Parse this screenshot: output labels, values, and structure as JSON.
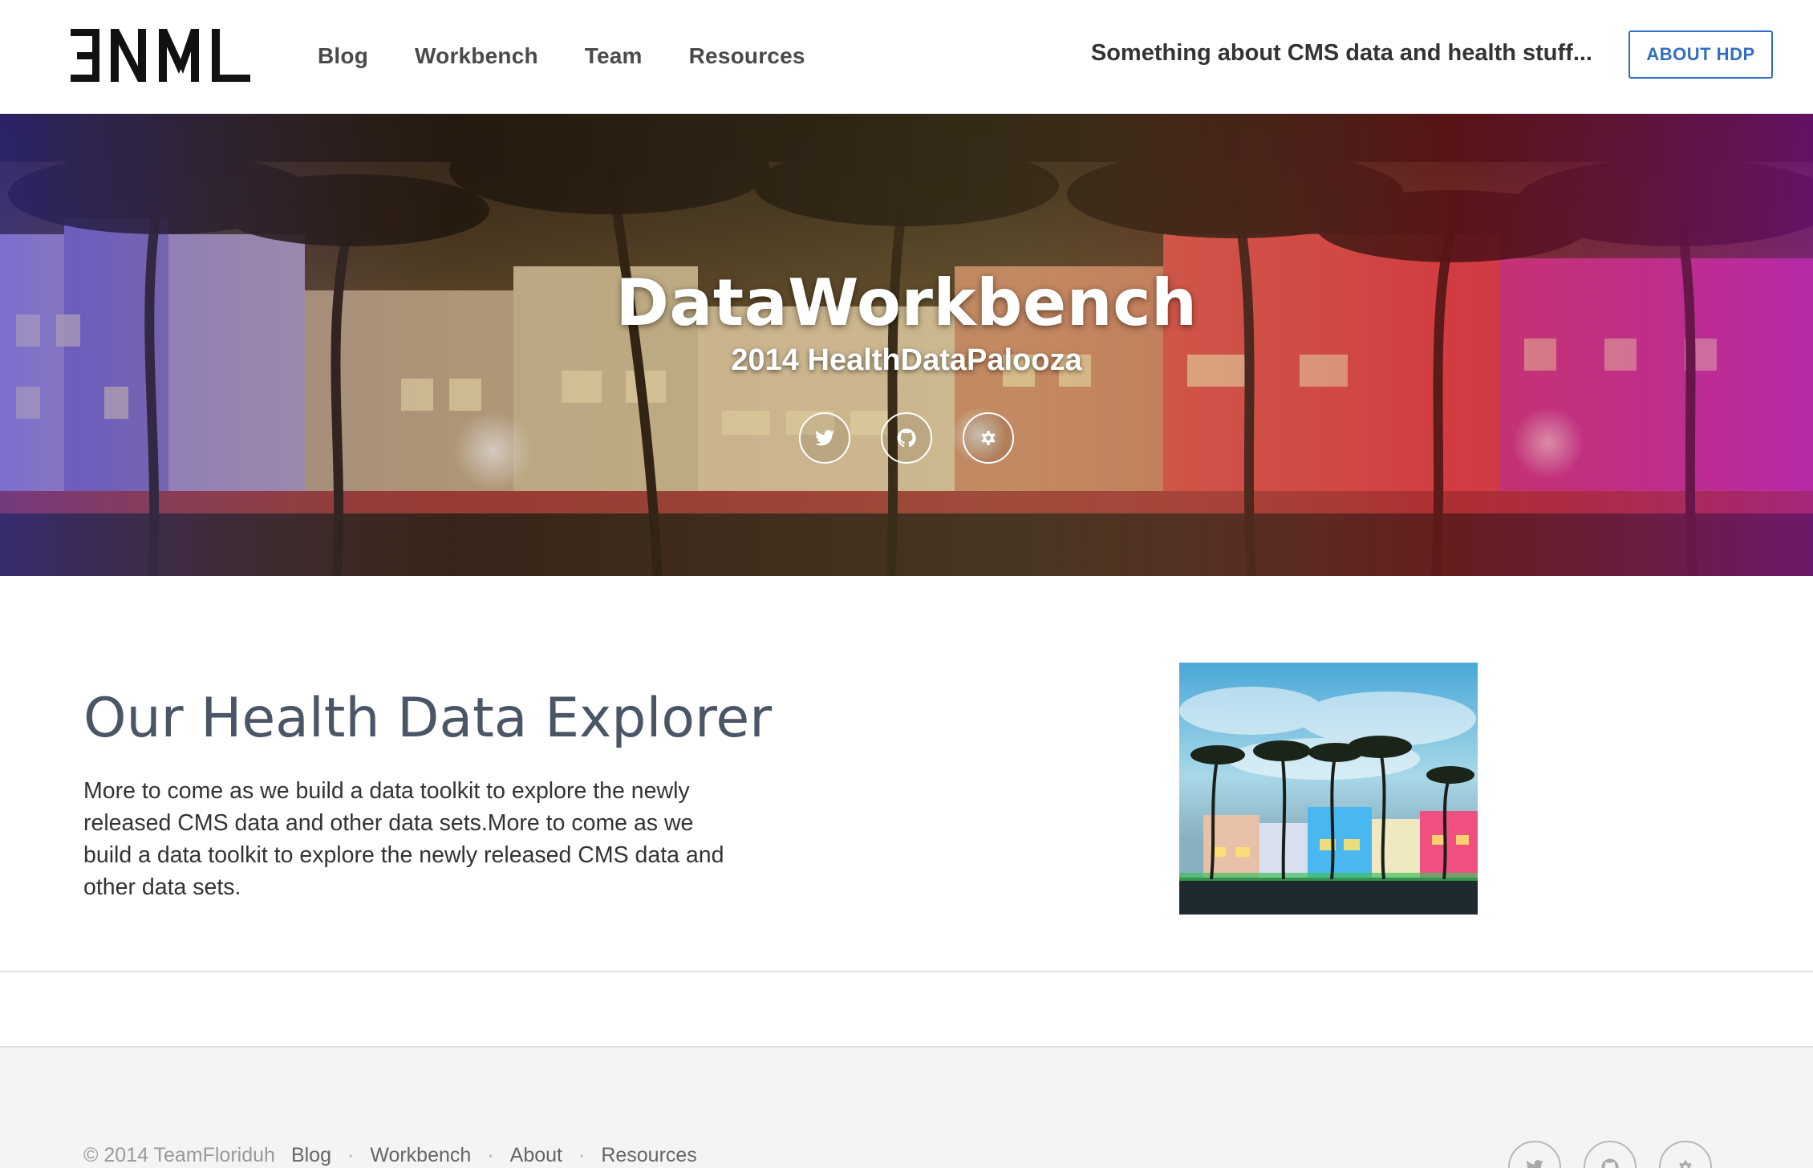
{
  "header": {
    "logo_text": "ƎNML",
    "nav": [
      {
        "label": "Blog"
      },
      {
        "label": "Workbench"
      },
      {
        "label": "Team"
      },
      {
        "label": "Resources"
      }
    ],
    "tagline": "Something about CMS data and health stuff...",
    "about_button": "ABOUT HDP"
  },
  "hero": {
    "title": "DataWorkbench",
    "subtitle": "2014 HealthDataPalooza",
    "icons": [
      "twitter-icon",
      "github-icon",
      "gear-icon"
    ]
  },
  "main": {
    "title": "Our Health Data Explorer",
    "body": "More to come as we build a data toolkit to explore the newly released CMS data and other data sets.More to come as we build a data toolkit to explore the newly released CMS data and other data sets."
  },
  "footer": {
    "copyright": "© 2014 TeamFloriduh",
    "links": [
      {
        "label": "Blog"
      },
      {
        "label": "Workbench"
      },
      {
        "label": "About"
      },
      {
        "label": "Resources"
      }
    ],
    "separator": "·",
    "icons": [
      "twitter-icon",
      "github-icon",
      "gear-icon"
    ]
  },
  "colors": {
    "accent": "#2f6ec2",
    "heading": "#4a5566",
    "text": "#333333",
    "footer_bg": "#f4f4f4"
  }
}
